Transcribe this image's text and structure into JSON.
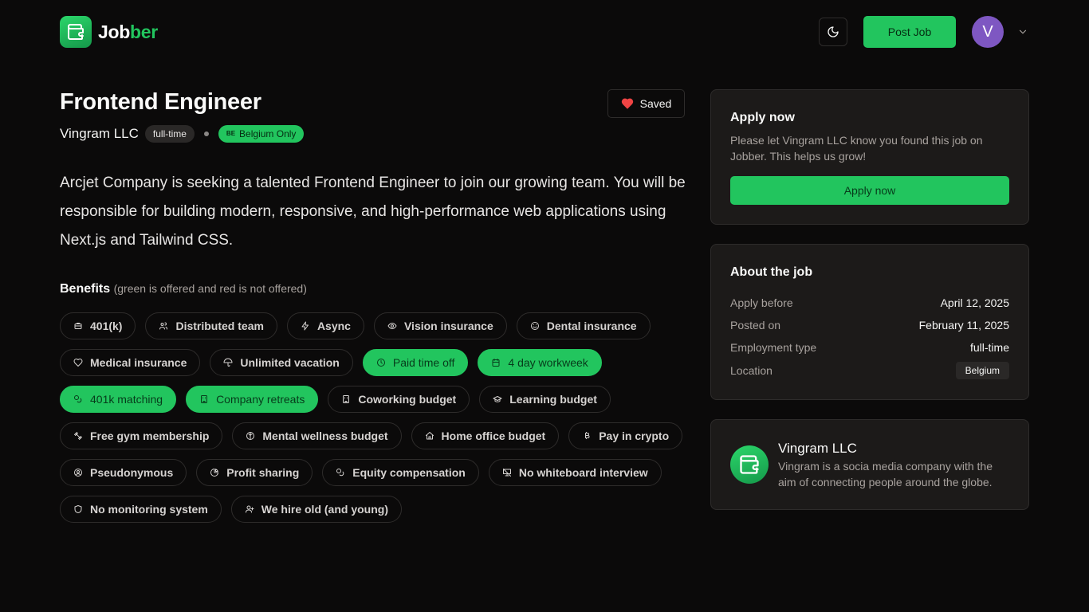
{
  "brand": {
    "name_part1": "Job",
    "name_part2": "ber"
  },
  "header": {
    "post_job_label": "Post Job",
    "avatar_initial": "V"
  },
  "job": {
    "title": "Frontend Engineer",
    "saved_label": "Saved",
    "company": "Vingram LLC",
    "employment_type": "full-time",
    "location_flag": "BE",
    "location_label": "Belgium Only",
    "description": "Arcjet Company is seeking a talented Frontend Engineer to join our growing team. You will be responsible for building modern, responsive, and high-performance web applications using Next.js and Tailwind CSS."
  },
  "benefits": {
    "title": "Benefits",
    "note": "(green is offered and red is not offered)",
    "rows": [
      [
        {
          "label": "401(k)",
          "icon": "piggy-bank-icon",
          "offered": false
        },
        {
          "label": "Distributed team",
          "icon": "users-icon",
          "offered": false
        },
        {
          "label": "Async",
          "icon": "zap-icon",
          "offered": false
        },
        {
          "label": "Vision insurance",
          "icon": "eye-icon",
          "offered": false
        },
        {
          "label": "Dental insurance",
          "icon": "smile-icon",
          "offered": false
        }
      ],
      [
        {
          "label": "Medical insurance",
          "icon": "heart-icon",
          "offered": false
        },
        {
          "label": "Unlimited vacation",
          "icon": "umbrella-icon",
          "offered": false
        },
        {
          "label": "Paid time off",
          "icon": "clock-icon",
          "offered": true
        },
        {
          "label": "4 day workweek",
          "icon": "calendar-icon",
          "offered": true
        }
      ],
      [
        {
          "label": "401k matching",
          "icon": "coins-icon",
          "offered": true
        },
        {
          "label": "Company retreats",
          "icon": "building-icon",
          "offered": true
        },
        {
          "label": "Coworking budget",
          "icon": "building-icon",
          "offered": false
        },
        {
          "label": "Learning budget",
          "icon": "graduation-cap-icon",
          "offered": false
        }
      ],
      [
        {
          "label": "Free gym membership",
          "icon": "dumbbell-icon",
          "offered": false
        },
        {
          "label": "Mental wellness budget",
          "icon": "brain-icon",
          "offered": false
        },
        {
          "label": "Home office budget",
          "icon": "home-icon",
          "offered": false
        },
        {
          "label": "Pay in crypto",
          "icon": "bitcoin-icon",
          "offered": false
        }
      ],
      [
        {
          "label": "Pseudonymous",
          "icon": "user-circle-icon",
          "offered": false
        },
        {
          "label": "Profit sharing",
          "icon": "pie-chart-icon",
          "offered": false
        },
        {
          "label": "Equity compensation",
          "icon": "coins-icon",
          "offered": false
        },
        {
          "label": "No whiteboard interview",
          "icon": "presentation-off-icon",
          "offered": false
        }
      ],
      [
        {
          "label": "No monitoring system",
          "icon": "shield-icon",
          "offered": false
        },
        {
          "label": "We hire old (and young)",
          "icon": "user-plus-icon",
          "offered": false
        }
      ]
    ]
  },
  "apply_card": {
    "title": "Apply now",
    "text": "Please let Vingram LLC know you found this job on Jobber. This helps us grow!",
    "button_label": "Apply now"
  },
  "about_card": {
    "title": "About the job",
    "rows": [
      {
        "label": "Apply before",
        "value": "April 12, 2025"
      },
      {
        "label": "Posted on",
        "value": "February 11, 2025"
      },
      {
        "label": "Employment type",
        "value": "full-time"
      },
      {
        "label": "Location",
        "value": "Belgium"
      }
    ]
  },
  "company_card": {
    "name": "Vingram LLC",
    "description": "Vingram is a socia media company with the aim of connecting people around the globe."
  },
  "colors": {
    "accent": "#22c55e",
    "background": "#0b0a0a",
    "card": "#1c1a19",
    "avatar": "#7e57c2"
  }
}
